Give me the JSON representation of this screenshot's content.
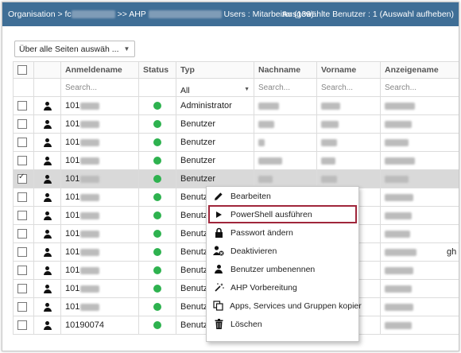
{
  "topbar": {
    "breadcrumb_start": "Organisation > fc",
    "breadcrumb_mid": ">> AHP",
    "breadcrumb_end": "Users : Mitarbeiter (139)",
    "selection": "Ausgewählte Benutzer : 1 (Auswahl aufheben)"
  },
  "toolbar": {
    "select_all_label": "Über alle Seiten auswäh ..."
  },
  "grid": {
    "columns": [
      "Anmeldename",
      "Status",
      "Typ",
      "Nachname",
      "Vorname",
      "Anzeigename"
    ],
    "filter_placeholder": "Search...",
    "type_filter_value": "All",
    "rows": [
      {
        "login": "101",
        "type": "Administrator",
        "checked": false
      },
      {
        "login": "101",
        "type": "Benutzer",
        "checked": false
      },
      {
        "login": "101",
        "type": "Benutzer",
        "checked": false
      },
      {
        "login": "101",
        "type": "Benutzer",
        "checked": false
      },
      {
        "login": "101",
        "type": "Benutzer",
        "checked": true
      },
      {
        "login": "101",
        "type": "Benutzer",
        "checked": false
      },
      {
        "login": "101",
        "type": "Benutze",
        "checked": false
      },
      {
        "login": "101",
        "type": "Benutze",
        "checked": false
      },
      {
        "login": "101",
        "type": "Benutze",
        "checked": false
      },
      {
        "login": "101",
        "type": "Benutze",
        "checked": false
      },
      {
        "login": "101",
        "type": "Benutze",
        "checked": false
      },
      {
        "login": "101",
        "type": "Benutze",
        "checked": false
      },
      {
        "login": "10190074",
        "type": "Benutze",
        "checked": false
      }
    ],
    "anzeigename_suffix": "gh",
    "status_color": "#2eb24f"
  },
  "context_menu": {
    "items": [
      {
        "label": "Bearbeiten",
        "icon": "pencil-icon"
      },
      {
        "label": "PowerShell ausführen",
        "icon": "play-icon"
      },
      {
        "label": "Passwort ändern",
        "icon": "lock-icon"
      },
      {
        "label": "Deaktivieren",
        "icon": "user-disable-icon"
      },
      {
        "label": "Benutzer umbenennen",
        "icon": "user-icon"
      },
      {
        "label": "AHP Vorbereitung",
        "icon": "magic-wand-icon"
      },
      {
        "label": "Apps, Services und Gruppen kopier",
        "icon": "copy-icon"
      },
      {
        "label": "Löschen",
        "icon": "trash-icon"
      }
    ],
    "highlight_color": "#a0263b"
  }
}
